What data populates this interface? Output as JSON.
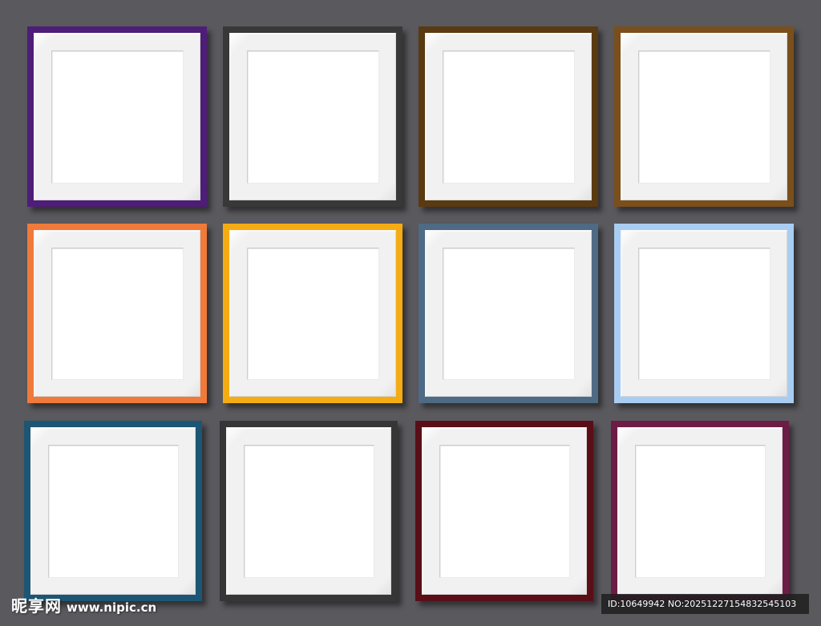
{
  "frames": [
    {
      "name": "frame-purple",
      "color": "#4e1d78"
    },
    {
      "name": "frame-charcoal",
      "color": "#383838"
    },
    {
      "name": "frame-dark-brown",
      "color": "#5a3a10"
    },
    {
      "name": "frame-brown",
      "color": "#7a4f1c"
    },
    {
      "name": "frame-orange",
      "color": "#f07a3a"
    },
    {
      "name": "frame-amber",
      "color": "#f5ac12"
    },
    {
      "name": "frame-slate-blue",
      "color": "#4e6a84"
    },
    {
      "name": "frame-light-blue",
      "color": "#a9cdf2"
    },
    {
      "name": "frame-teal-blue",
      "color": "#1d5574"
    },
    {
      "name": "frame-dark-grey",
      "color": "#363636"
    },
    {
      "name": "frame-maroon",
      "color": "#5a0f18"
    },
    {
      "name": "frame-plum",
      "color": "#6d1d45"
    }
  ],
  "watermark": {
    "site_name": "昵享网",
    "url": "www.nipic.cn",
    "id_text": "ID:10649942 NO:20251227154832545103"
  }
}
